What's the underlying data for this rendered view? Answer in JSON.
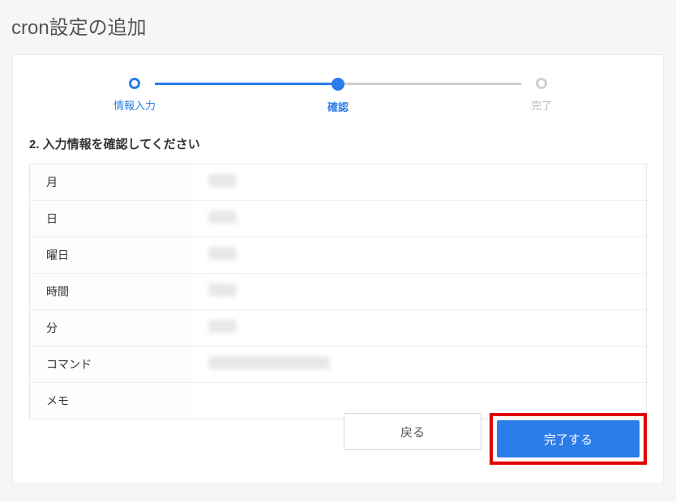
{
  "page": {
    "title": "cron設定の追加"
  },
  "stepper": {
    "steps": [
      {
        "label": "情報入力",
        "state": "done"
      },
      {
        "label": "確認",
        "state": "active"
      },
      {
        "label": "完了",
        "state": "incomplete"
      }
    ]
  },
  "section": {
    "heading": "2. 入力情報を確認してください"
  },
  "fields": {
    "month": {
      "label": "月",
      "value": ""
    },
    "day": {
      "label": "日",
      "value": ""
    },
    "weekday": {
      "label": "曜日",
      "value": ""
    },
    "hour": {
      "label": "時間",
      "value": ""
    },
    "minute": {
      "label": "分",
      "value": ""
    },
    "command": {
      "label": "コマンド",
      "value": ""
    },
    "memo": {
      "label": "メモ",
      "value": ""
    }
  },
  "buttons": {
    "back": "戻る",
    "complete": "完了する"
  }
}
